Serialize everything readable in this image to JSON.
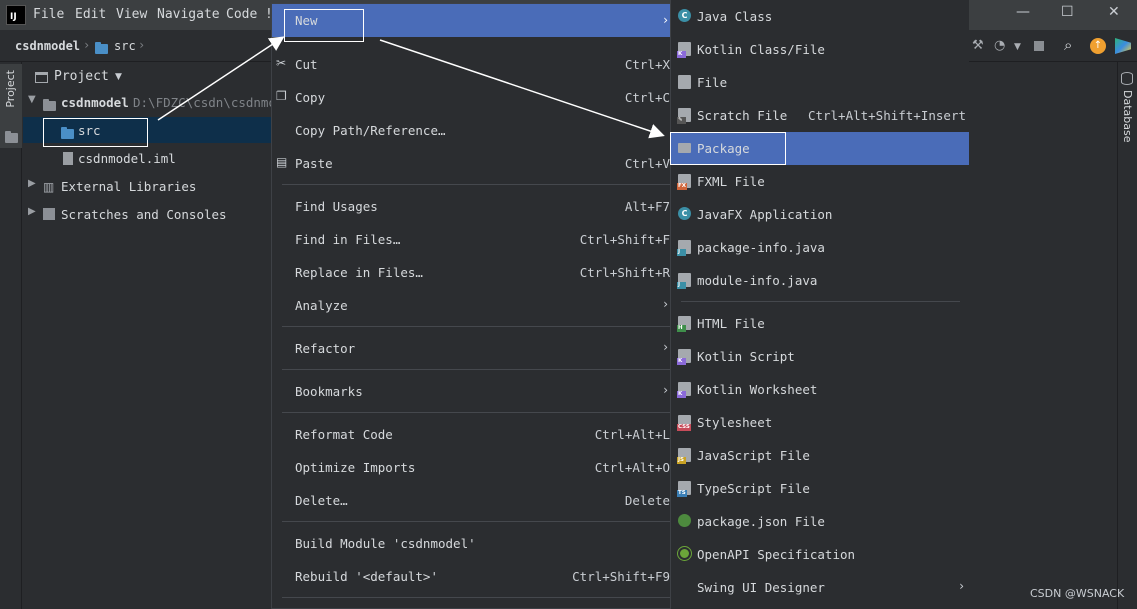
{
  "menubar": {
    "logo": "IJ",
    "items": [
      "File",
      "Edit",
      "View",
      "Navigate",
      "Code",
      "!"
    ],
    "window_controls": {
      "minimize": "—",
      "maximize": "☐",
      "close": "✕"
    }
  },
  "breadcrumb": {
    "project": "csdnmodel",
    "folder": "src"
  },
  "project_panel": {
    "title": "Project",
    "root_name": "csdnmodel",
    "root_path": "D:\\FDZC\\csdn\\csdnmodel",
    "src": "src",
    "iml": "csdnmodel.iml",
    "external_libraries": "External Libraries",
    "scratches": "Scratches and Consoles"
  },
  "context_menu": {
    "new": "New",
    "cut": "Cut",
    "cut_sc": "Ctrl+X",
    "copy": "Copy",
    "copy_sc": "Ctrl+C",
    "copy_path": "Copy Path/Reference…",
    "paste": "Paste",
    "paste_sc": "Ctrl+V",
    "find_usages": "Find Usages",
    "find_usages_sc": "Alt+F7",
    "find_in_files": "Find in Files…",
    "find_in_files_sc": "Ctrl+Shift+F",
    "replace_in_files": "Replace in Files…",
    "replace_in_files_sc": "Ctrl+Shift+R",
    "analyze": "Analyze",
    "refactor": "Refactor",
    "bookmarks": "Bookmarks",
    "reformat": "Reformat Code",
    "reformat_sc": "Ctrl+Alt+L",
    "optimize": "Optimize Imports",
    "optimize_sc": "Ctrl+Alt+O",
    "delete": "Delete…",
    "delete_sc": "Delete",
    "build_module": "Build Module 'csdnmodel'",
    "rebuild": "Rebuild '<default>'",
    "rebuild_sc": "Ctrl+Shift+F9"
  },
  "submenu": {
    "java_class": "Java Class",
    "kotlin_class": "Kotlin Class/File",
    "file": "File",
    "scratch": "Scratch File",
    "scratch_sc": "Ctrl+Alt+Shift+Insert",
    "package": "Package",
    "fxml": "FXML File",
    "javafx": "JavaFX Application",
    "package_info": "package-info.java",
    "module_info": "module-info.java",
    "html": "HTML File",
    "kotlin_script": "Kotlin Script",
    "kotlin_worksheet": "Kotlin Worksheet",
    "stylesheet": "Stylesheet",
    "javascript": "JavaScript File",
    "typescript": "TypeScript File",
    "package_json": "package.json File",
    "openapi": "OpenAPI Specification",
    "swing": "Swing UI Designer"
  },
  "sidebar_right": {
    "database": "Database"
  },
  "watermark": "CSDN @WSNACK",
  "colors": {
    "selection": "#4a6cb8",
    "tree_selection": "#0e2f4a",
    "background": "#2b2d30"
  }
}
